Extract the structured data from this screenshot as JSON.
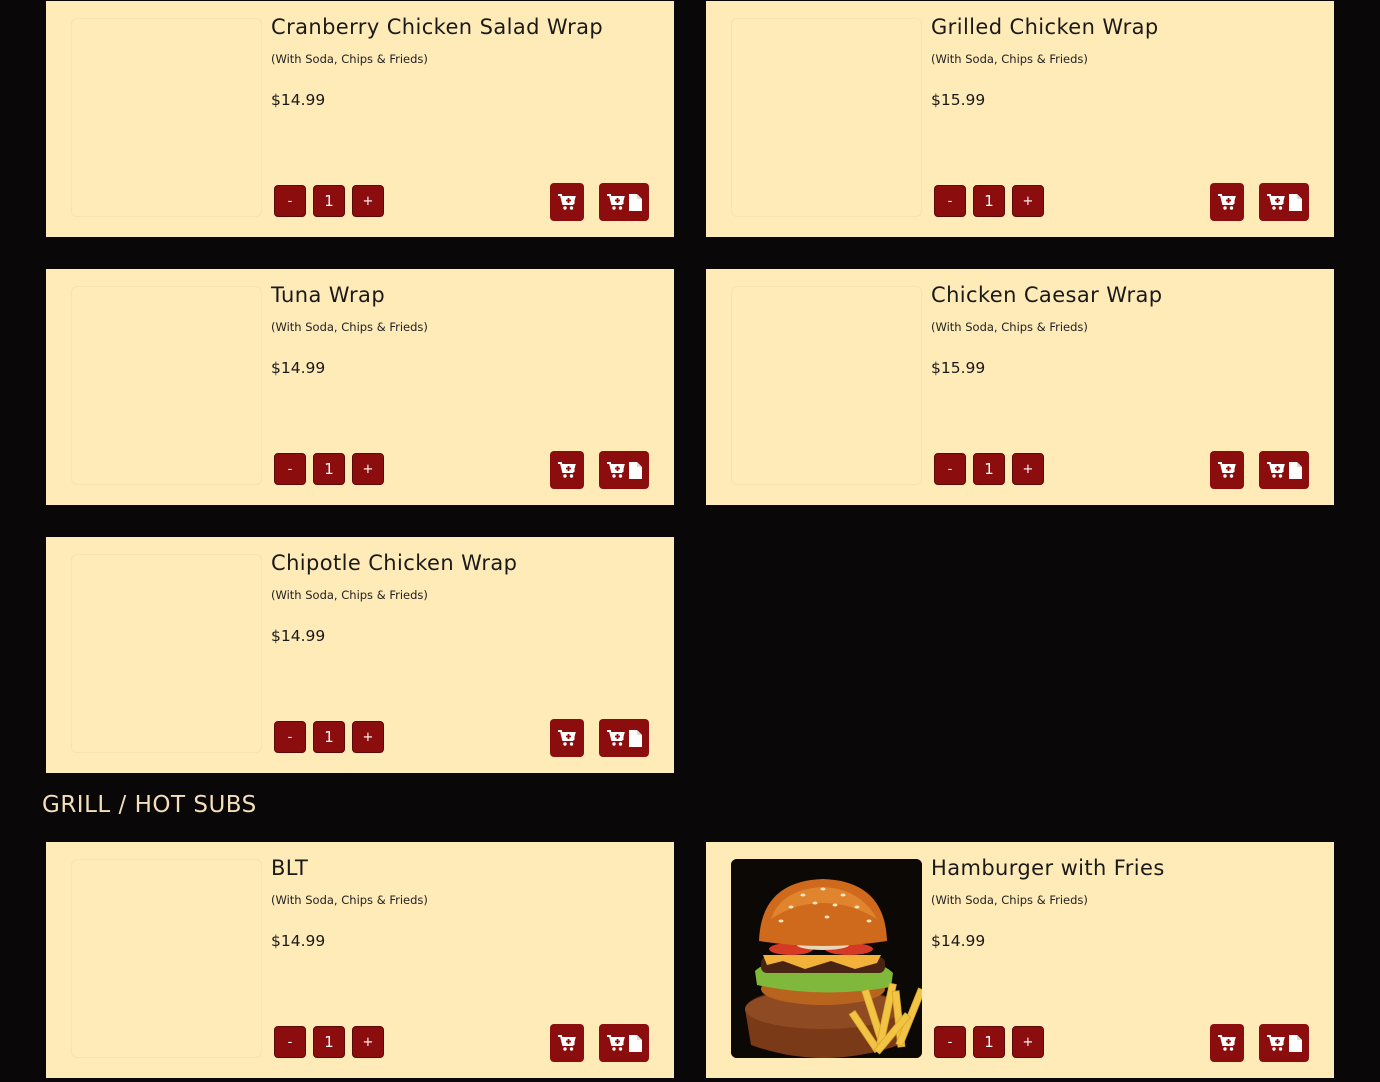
{
  "colors": {
    "page_bg": "#0a0708",
    "card_bg": "#ffebb8",
    "button_bg": "#8c0d0d",
    "section_title": "#f3dfb8"
  },
  "icons": {
    "add_to_cart": "cart-plus-icon",
    "add_with_notes": "file-icon"
  },
  "wraps": [
    {
      "title": "Cranberry Chicken Salad Wrap",
      "subtitle": "(With Soda, Chips & Frieds)",
      "price": "$14.99",
      "qty": "1",
      "minus": "-",
      "plus": "+"
    },
    {
      "title": "Grilled Chicken Wrap",
      "subtitle": "(With Soda, Chips & Frieds)",
      "price": "$15.99",
      "qty": "1",
      "minus": "-",
      "plus": "+"
    },
    {
      "title": "Tuna Wrap",
      "subtitle": "(With Soda, Chips & Frieds)",
      "price": "$14.99",
      "qty": "1",
      "minus": "-",
      "plus": "+"
    },
    {
      "title": "Chicken Caesar Wrap",
      "subtitle": "(With Soda, Chips & Frieds)",
      "price": "$15.99",
      "qty": "1",
      "minus": "-",
      "plus": "+"
    },
    {
      "title": "Chipotle Chicken Wrap",
      "subtitle": "(With Soda, Chips & Frieds)",
      "price": "$14.99",
      "qty": "1",
      "minus": "-",
      "plus": "+"
    }
  ],
  "grill_section": {
    "title": "GRILL / HOT SUBS",
    "items": [
      {
        "title": "BLT",
        "subtitle": "(With Soda, Chips & Frieds)",
        "price": "$14.99",
        "qty": "1",
        "minus": "-",
        "plus": "+"
      },
      {
        "title": "Hamburger with Fries",
        "subtitle": "(With Soda, Chips & Frieds)",
        "price": "$14.99",
        "qty": "1",
        "minus": "-",
        "plus": "+",
        "image": "hamburger-with-fries-photo"
      }
    ]
  }
}
